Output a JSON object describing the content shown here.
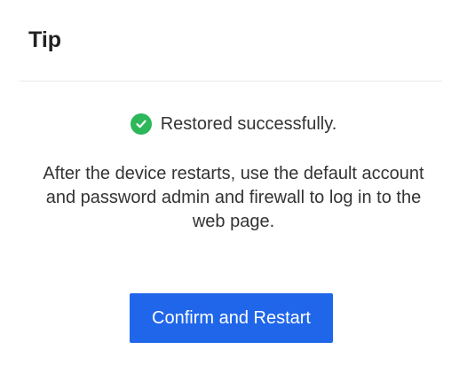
{
  "dialog": {
    "title": "Tip",
    "status": {
      "icon": "check-circle-icon",
      "color": "#2db75a",
      "text": "Restored successfully."
    },
    "message": "After the device restarts, use the default account and password admin and firewall to log in to the web page.",
    "confirm_label": "Confirm and Restart",
    "accent_color": "#1f66ea"
  }
}
